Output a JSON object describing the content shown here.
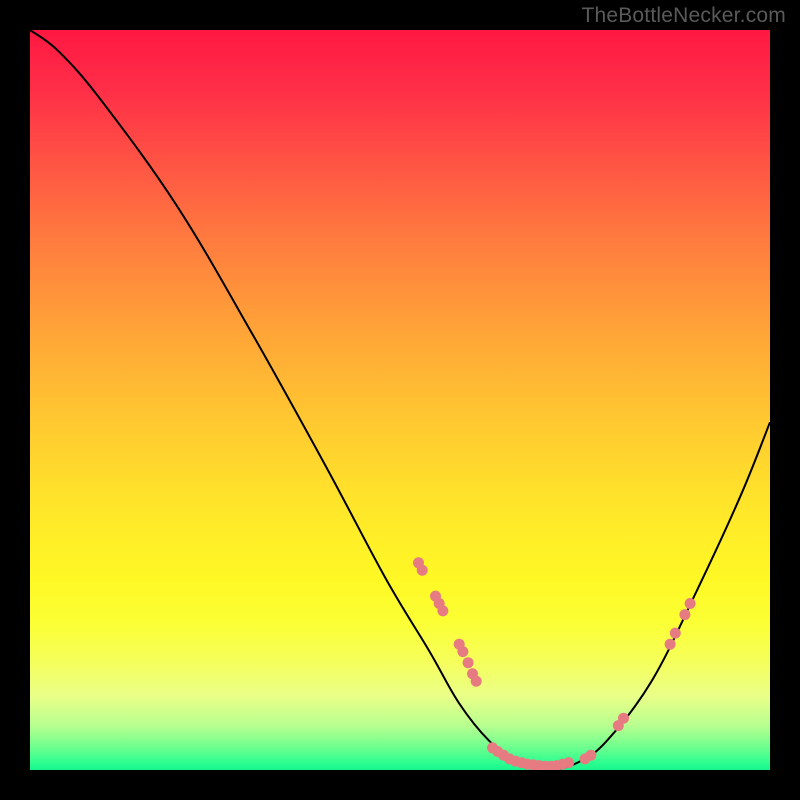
{
  "watermark": "TheBottleNecker.com",
  "chart_data": {
    "type": "line",
    "title": "",
    "xlabel": "",
    "ylabel": "",
    "xlim": [
      0,
      100
    ],
    "ylim": [
      0,
      100
    ],
    "curve": [
      {
        "x": 0,
        "y": 100
      },
      {
        "x": 4,
        "y": 97
      },
      {
        "x": 10,
        "y": 90
      },
      {
        "x": 20,
        "y": 76
      },
      {
        "x": 30,
        "y": 59
      },
      {
        "x": 40,
        "y": 41
      },
      {
        "x": 48,
        "y": 26
      },
      {
        "x": 54,
        "y": 16
      },
      {
        "x": 58,
        "y": 9
      },
      {
        "x": 62,
        "y": 4
      },
      {
        "x": 66,
        "y": 1
      },
      {
        "x": 70,
        "y": 0
      },
      {
        "x": 74,
        "y": 1
      },
      {
        "x": 78,
        "y": 4
      },
      {
        "x": 84,
        "y": 12
      },
      {
        "x": 90,
        "y": 24
      },
      {
        "x": 96,
        "y": 37
      },
      {
        "x": 100,
        "y": 47
      }
    ],
    "marker_cluster_left": [
      {
        "x": 52.5,
        "y": 28.0
      },
      {
        "x": 53.0,
        "y": 27.0
      },
      {
        "x": 54.8,
        "y": 23.5
      },
      {
        "x": 55.3,
        "y": 22.5
      },
      {
        "x": 55.8,
        "y": 21.5
      },
      {
        "x": 58.0,
        "y": 17.0
      },
      {
        "x": 58.5,
        "y": 16.0
      },
      {
        "x": 59.2,
        "y": 14.5
      },
      {
        "x": 59.8,
        "y": 13.0
      },
      {
        "x": 60.3,
        "y": 12.0
      }
    ],
    "marker_cluster_bottom": [
      {
        "x": 62.5,
        "y": 3.0
      },
      {
        "x": 63.2,
        "y": 2.5
      },
      {
        "x": 64.0,
        "y": 2.0
      },
      {
        "x": 64.8,
        "y": 1.5
      },
      {
        "x": 65.6,
        "y": 1.2
      },
      {
        "x": 66.4,
        "y": 1.0
      },
      {
        "x": 67.2,
        "y": 0.8
      },
      {
        "x": 68.0,
        "y": 0.7
      },
      {
        "x": 68.8,
        "y": 0.6
      },
      {
        "x": 69.6,
        "y": 0.5
      },
      {
        "x": 70.4,
        "y": 0.5
      },
      {
        "x": 71.2,
        "y": 0.6
      },
      {
        "x": 72.0,
        "y": 0.8
      },
      {
        "x": 72.8,
        "y": 1.0
      },
      {
        "x": 75.0,
        "y": 1.5
      },
      {
        "x": 75.8,
        "y": 2.0
      }
    ],
    "marker_cluster_right": [
      {
        "x": 79.5,
        "y": 6.0
      },
      {
        "x": 80.2,
        "y": 7.0
      },
      {
        "x": 86.5,
        "y": 17.0
      },
      {
        "x": 87.2,
        "y": 18.5
      },
      {
        "x": 88.5,
        "y": 21.0
      },
      {
        "x": 89.2,
        "y": 22.5
      }
    ],
    "marker_color": "#e67c82",
    "curve_color": "#000000",
    "curve_width": 2.0
  }
}
